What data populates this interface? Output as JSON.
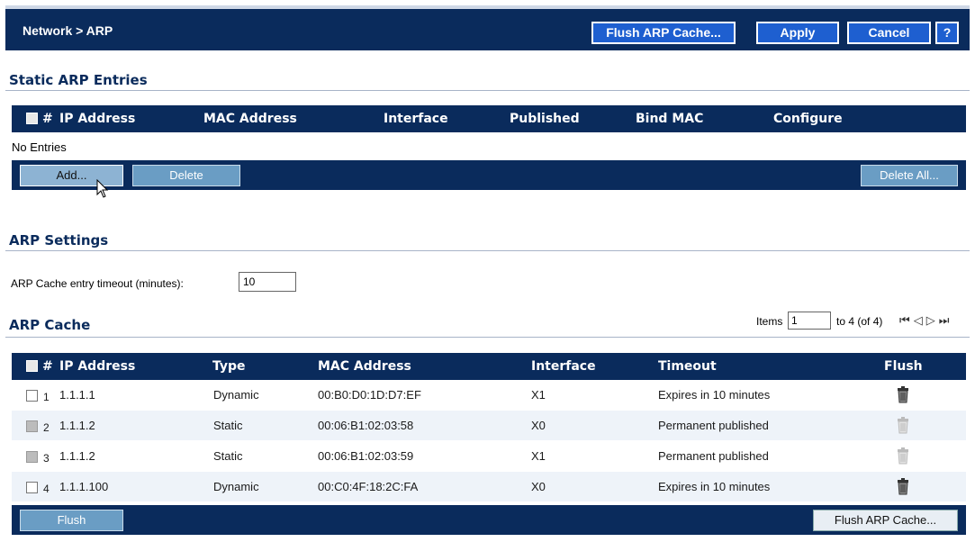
{
  "header": {
    "title": "Network > ARP",
    "flush_arp_cache_label": "Flush ARP Cache...",
    "apply_label": "Apply",
    "cancel_label": "Cancel",
    "help_label": "?"
  },
  "static_arp": {
    "section_title": "Static ARP Entries",
    "columns": [
      "#",
      "IP Address",
      "MAC Address",
      "Interface",
      "Published",
      "Bind MAC",
      "Configure"
    ],
    "empty_text": "No Entries",
    "add_label": "Add...",
    "delete_label": "Delete",
    "delete_all_label": "Delete All..."
  },
  "arp_settings": {
    "section_title": "ARP Settings",
    "timeout_label": "ARP Cache entry timeout (minutes):",
    "timeout_value": "10"
  },
  "arp_cache": {
    "section_title": "ARP Cache",
    "items_label": "Items",
    "items_value": "1",
    "range_text": "to 4 (of 4)",
    "columns": [
      "#",
      "IP Address",
      "Type",
      "MAC Address",
      "Interface",
      "Timeout",
      "Flush"
    ],
    "rows": [
      {
        "num": "1",
        "ip": "1.1.1.1",
        "type": "Dynamic",
        "mac": "00:B0:D0:1D:D7:EF",
        "iface": "X1",
        "timeout": "Expires in 10 minutes",
        "checkbox_enabled": true,
        "flush_enabled": true
      },
      {
        "num": "2",
        "ip": "1.1.1.2",
        "type": "Static",
        "mac": "00:06:B1:02:03:58",
        "iface": "X0",
        "timeout": "Permanent published",
        "checkbox_enabled": false,
        "flush_enabled": false
      },
      {
        "num": "3",
        "ip": "1.1.1.2",
        "type": "Static",
        "mac": "00:06:B1:02:03:59",
        "iface": "X1",
        "timeout": "Permanent published",
        "checkbox_enabled": false,
        "flush_enabled": false
      },
      {
        "num": "4",
        "ip": "1.1.1.100",
        "type": "Dynamic",
        "mac": "00:C0:4F:18:2C:FA",
        "iface": "X0",
        "timeout": "Expires in 10 minutes",
        "checkbox_enabled": true,
        "flush_enabled": true
      }
    ],
    "flush_label": "Flush",
    "flush_cache_label": "Flush ARP Cache..."
  },
  "colors": {
    "navy": "#0a2b5c",
    "header_button": "#1e5fd0",
    "row_alt": "#eef3f9"
  },
  "icons": [
    "trash-icon",
    "first-page-icon",
    "prev-page-icon",
    "next-page-icon",
    "last-page-icon",
    "mouse-cursor-icon"
  ]
}
